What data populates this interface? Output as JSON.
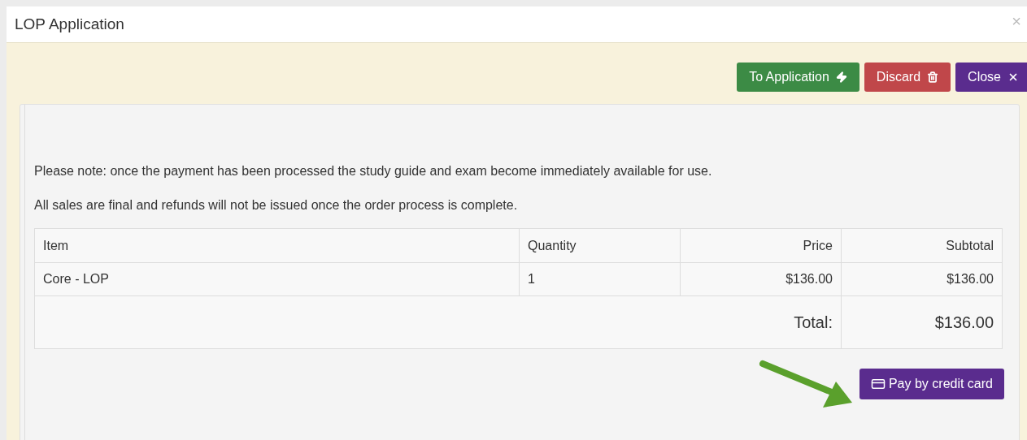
{
  "window": {
    "title": "LOP Application",
    "close": "×"
  },
  "toolbar": [
    {
      "label": "To Application",
      "kind": "application"
    },
    {
      "label": "Discard",
      "kind": "discard"
    },
    {
      "label": "Close",
      "kind": "close"
    }
  ],
  "notes": [
    "Please note: once the payment has been processed the study guide and exam become immediately available for use.",
    "All sales are final and refunds will not be issued once the order process is complete."
  ],
  "table": {
    "columns": [
      "Item",
      "Quantity",
      "Price",
      "Subtotal"
    ],
    "rows": [
      [
        "Core - LOP",
        "1",
        "$136.00",
        "$136.00"
      ]
    ],
    "total_label": "Total:",
    "total": "$136.00"
  },
  "pay_button": "Pay by credit card"
}
